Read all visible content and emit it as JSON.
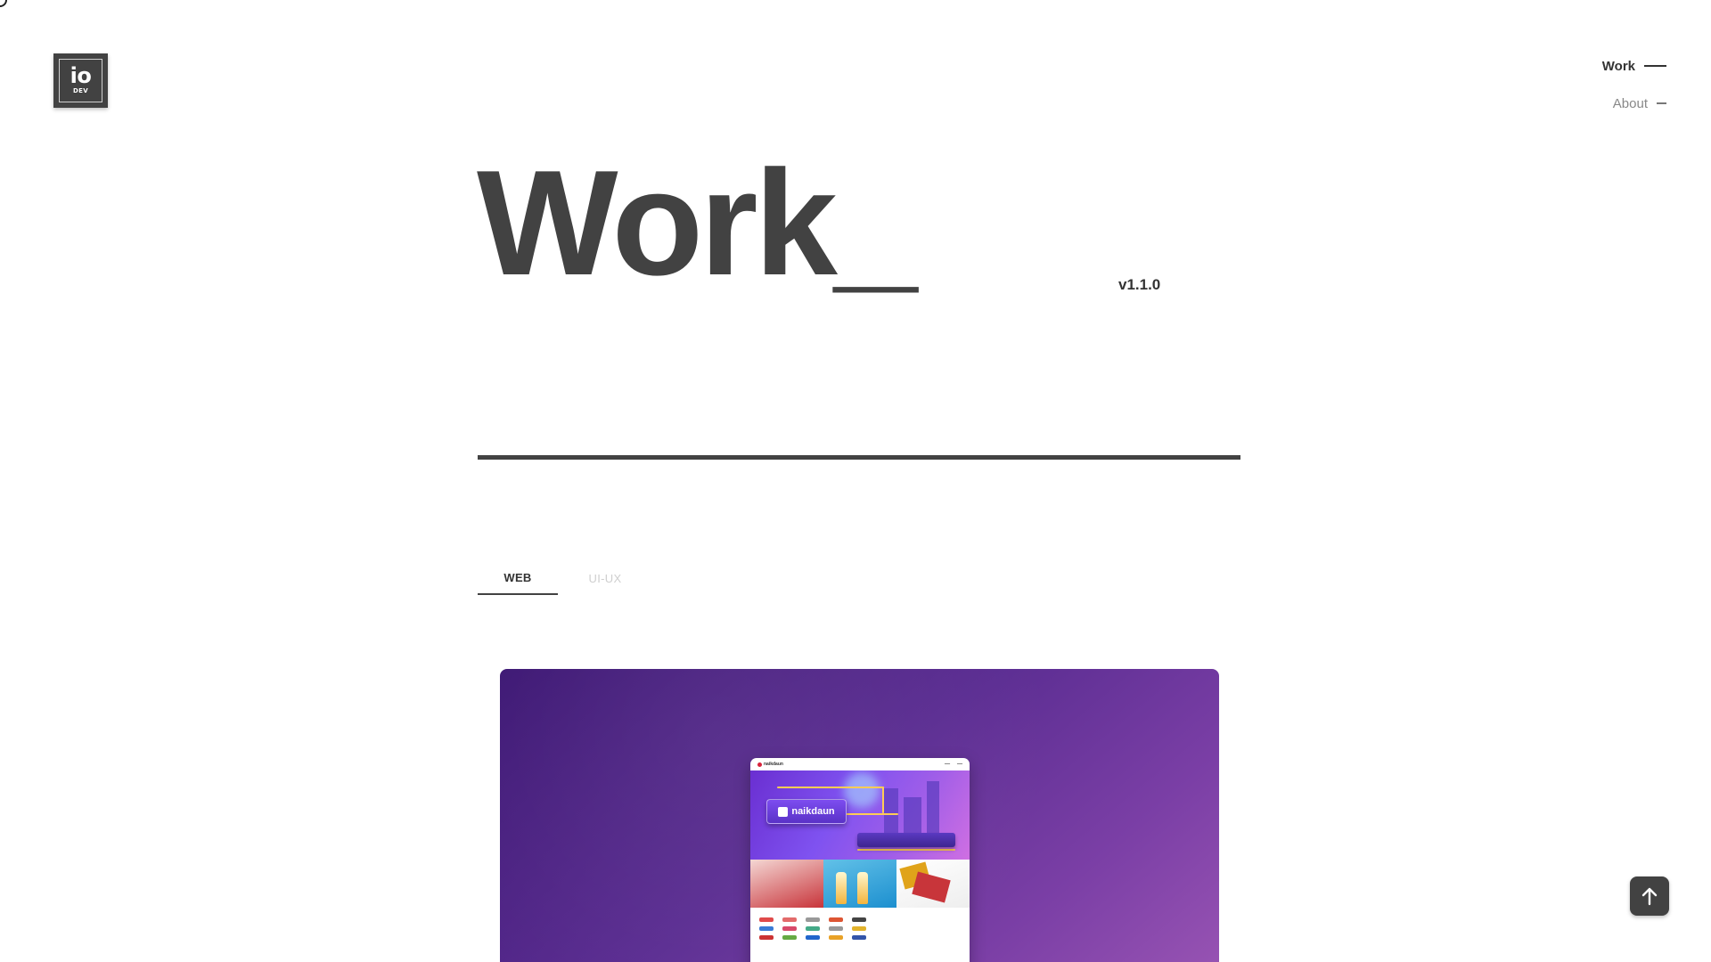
{
  "logo": {
    "main": "io",
    "sub": "DEV"
  },
  "nav": {
    "items": [
      {
        "label": "Work",
        "active": true
      },
      {
        "label": "About",
        "active": false
      }
    ]
  },
  "hero": {
    "title": "Work_",
    "version": "v1.1.0"
  },
  "tabs": [
    {
      "label": "WEB",
      "active": true
    },
    {
      "label": "UI-UX",
      "active": false
    }
  ],
  "project_card": {
    "background_colors": [
      "#3c1673",
      "#9a55b4"
    ],
    "preview": {
      "brand": "naikdaun",
      "hero_logo_text": "naikdaun"
    }
  },
  "scroll_to_top": {
    "icon": "arrow-up-icon"
  },
  "colors": {
    "primary": "#424242",
    "inactive_text": "#888888",
    "inactive_tab": "#cfcfcf"
  }
}
